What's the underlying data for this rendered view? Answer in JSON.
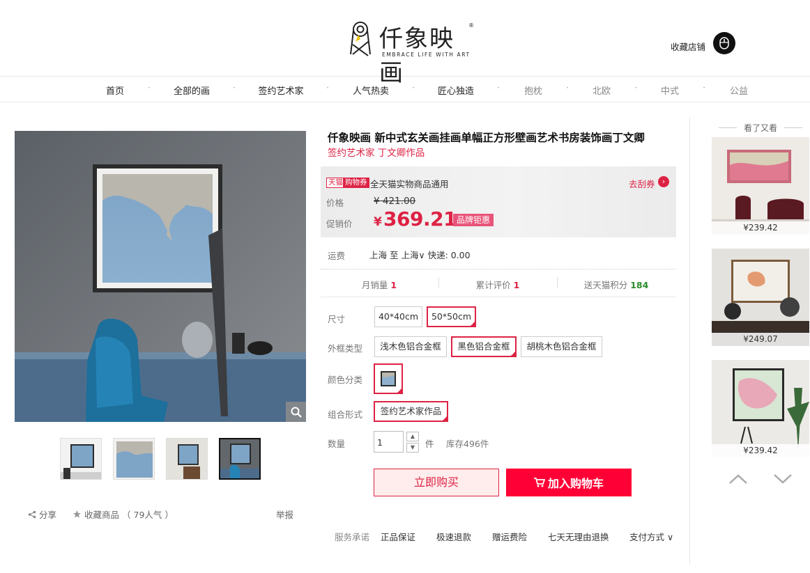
{
  "header": {
    "logo_text": "仟象映画",
    "logo_reg": "®",
    "logo_sub": "EMBRACE LIFE WITH ART",
    "fav_store": "收藏店铺"
  },
  "nav": {
    "items": [
      "首页",
      "全部的画",
      "签约艺术家",
      "人气热卖",
      "匠心独造",
      "抱枕",
      "北欧",
      "中式",
      "公益"
    ],
    "dot": "·"
  },
  "product": {
    "title": "仟象映画 新中式玄关画挂画单幅正方形壁画艺术书房装饰画丁文卿",
    "subtitle": "签约艺术家 丁文卿作品",
    "tag_tmall": "天猫",
    "tag_coupon": "购物券",
    "coupon_text": "全天猫实物商品通用",
    "get_coupon": "去刮券",
    "price_label": "价格",
    "old_price": "¥ 421.00",
    "sale_label": "促销价",
    "sale_yen": "¥",
    "sale_price": "369.21",
    "brand_tag": "品牌钜惠",
    "ship_label": "运费",
    "ship_value": "上海  至 上海∨  快递: 0.00",
    "stats": {
      "monthly_label": "月销量",
      "monthly_value": "1",
      "reviews_label": "累计评价",
      "reviews_value": "1",
      "points_label": "送天猫积分",
      "points_value": "184"
    },
    "size_label": "尺寸",
    "sizes": [
      "40*40cm",
      "50*50cm"
    ],
    "frame_label": "外框类型",
    "frames": [
      "浅木色铝合金框",
      "黑色铝合金框",
      "胡桃木色铝合金框"
    ],
    "color_label": "颜色分类",
    "combo_label": "组合形式",
    "combo": "签约艺术家作品",
    "qty_label": "数量",
    "qty_value": "1",
    "qty_unit": "件",
    "stock": "库存496件",
    "buy_now": "立即购买",
    "add_cart": "加入购物车"
  },
  "gallery": {
    "share": "分享",
    "favorite": "收藏商品",
    "favorite_count": "（ 79人气 ）",
    "report": "举报"
  },
  "services": {
    "label": "服务承诺",
    "items": [
      "正品保证",
      "极速退款",
      "赠运费险",
      "七天无理由退换"
    ],
    "payment": "支付方式"
  },
  "recommend": {
    "title": "看了又看",
    "items": [
      {
        "price": "¥239.42"
      },
      {
        "price": "¥249.07"
      },
      {
        "price": "¥239.42"
      }
    ]
  },
  "colors": {
    "accent": "#dd2244",
    "cart": "#ff0036",
    "points_green": "#2a8c2a"
  }
}
